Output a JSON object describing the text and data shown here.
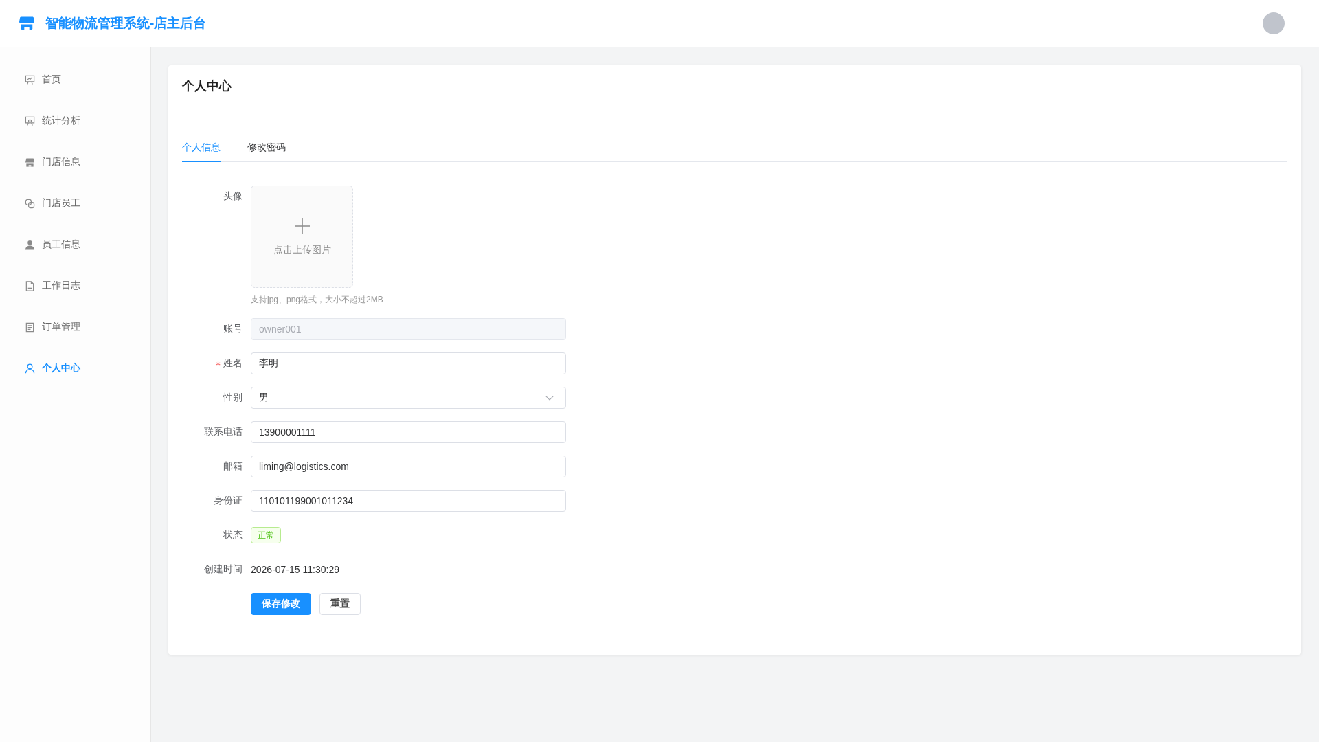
{
  "app": {
    "title": "智能物流管理系统-店主后台"
  },
  "sidebar": {
    "items": [
      {
        "label": "首页",
        "selected": false
      },
      {
        "label": "统计分析",
        "selected": false
      },
      {
        "label": "门店信息",
        "selected": false
      },
      {
        "label": "门店员工",
        "selected": false
      },
      {
        "label": "员工信息",
        "selected": false
      },
      {
        "label": "工作日志",
        "selected": false
      },
      {
        "label": "订单管理",
        "selected": false
      },
      {
        "label": "个人中心",
        "selected": true
      }
    ]
  },
  "page": {
    "title": "个人中心"
  },
  "tabs": [
    {
      "label": "个人信息",
      "selected": true
    },
    {
      "label": "修改密码",
      "selected": false
    }
  ],
  "form": {
    "avatar": {
      "label": "头像",
      "upload_text": "点击上传图片",
      "hint": "支持jpg、png格式，大小不超过2MB"
    },
    "fields": [
      {
        "kind": "input",
        "label": "账号",
        "value": "owner001",
        "disabled": true,
        "required": false
      },
      {
        "kind": "input",
        "label": "姓名",
        "value": "李明",
        "disabled": false,
        "required": true
      },
      {
        "kind": "select",
        "label": "性别",
        "value": "男",
        "disabled": false,
        "required": false
      },
      {
        "kind": "input",
        "label": "联系电话",
        "value": "13900001111",
        "disabled": false,
        "required": false
      },
      {
        "kind": "input",
        "label": "邮箱",
        "value": "liming@logistics.com",
        "disabled": false,
        "required": false
      },
      {
        "kind": "input",
        "label": "身份证",
        "value": "110101199001011234",
        "disabled": false,
        "required": false
      },
      {
        "kind": "tag",
        "label": "状态",
        "value": "正常",
        "required": false
      },
      {
        "kind": "text",
        "label": "创建时间",
        "value": "2026-07-15 11:30:29",
        "required": false
      }
    ],
    "buttons": [
      {
        "kind": "primary",
        "label": "保存修改"
      },
      {
        "kind": "default",
        "label": "重置"
      }
    ]
  }
}
